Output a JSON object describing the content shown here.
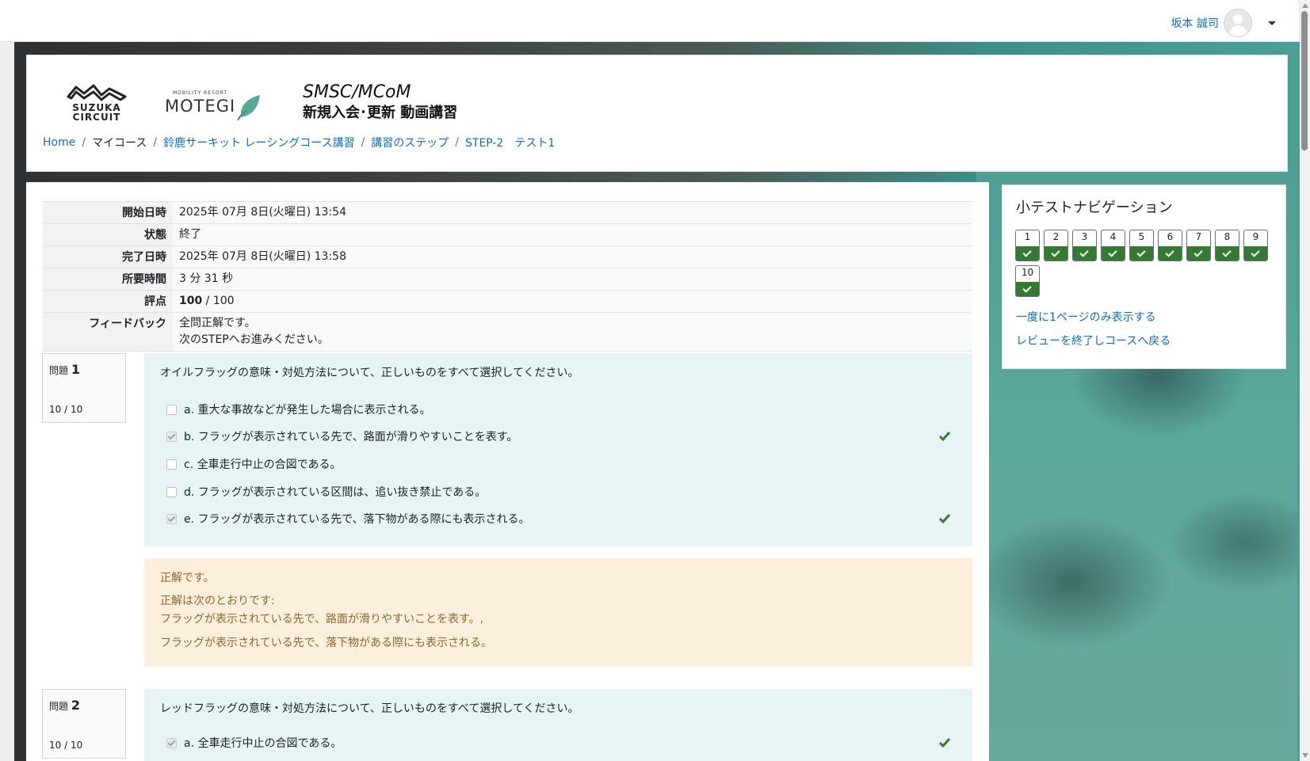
{
  "navbar": {
    "user_name": "坂本 誠司"
  },
  "header": {
    "logo_suzuka_text": "SUZUKA CIRCUIT",
    "logo_motegi_small": "MOBILITY RESORT",
    "logo_motegi_big": "MOTEGI",
    "title_line1": "SMSC/MCoM",
    "title_line2": "新規入会･更新 動画講習",
    "breadcrumb": [
      "Home",
      "マイコース",
      "鈴鹿サーキット レーシングコース講習",
      "講習のステップ",
      "STEP-2　テスト1"
    ]
  },
  "summary": {
    "rows": [
      {
        "label": "開始日時",
        "value": "2025年 07月 8日(火曜日) 13:54"
      },
      {
        "label": "状態",
        "value": "終了"
      },
      {
        "label": "完了日時",
        "value": "2025年 07月 8日(火曜日) 13:58"
      },
      {
        "label": "所要時間",
        "value": "3 分 31 秒"
      }
    ],
    "grade_label": "評点",
    "grade_value": "100",
    "grade_max": " / 100",
    "feedback_label": "フィードバック",
    "feedback_line1": "全問正解です。",
    "feedback_line2": "次のSTEPへお進みください。"
  },
  "questions": [
    {
      "label": "問題",
      "number": "1",
      "mark": "10 / 10",
      "text": "オイルフラッグの意味・対処方法について、正しいものをすべて選択してください。",
      "answers": [
        {
          "text": "a. 重大な事故などが発生した場合に表示される。",
          "checked": false,
          "correct": false
        },
        {
          "text": "b. フラッグが表示されている先で、路面が滑りやすいことを表す。",
          "checked": true,
          "correct": true
        },
        {
          "text": "c. 全車走行中止の合図である。",
          "checked": false,
          "correct": false
        },
        {
          "text": "d. フラッグが表示されている区間は、追い抜き禁止である。",
          "checked": false,
          "correct": false
        },
        {
          "text": "e. フラッグが表示されている先で、落下物がある際にも表示される。",
          "checked": true,
          "correct": true
        }
      ],
      "feedback": "正解です。",
      "right_answer_intro": "正解は次のとおりです:",
      "right_answer_1": "フラッグが表示されている先で、路面が滑りやすいことを表す。,",
      "right_answer_2": "フラッグが表示されている先で、落下物がある際にも表示される。"
    },
    {
      "label": "問題",
      "number": "2",
      "mark": "10 / 10",
      "text": "レッドフラッグの意味・対処方法について、正しいものをすべて選択してください。",
      "answers": [
        {
          "text": "a. 全車走行中止の合図である。",
          "checked": true,
          "correct": true
        }
      ]
    }
  ],
  "quiz_nav": {
    "title": "小テストナビゲーション",
    "buttons": [
      "1",
      "2",
      "3",
      "4",
      "5",
      "6",
      "7",
      "8",
      "9",
      "10"
    ],
    "link_single_page": "一度に1ページのみ表示する",
    "link_finish_review": "レビューを終了しコースへ戻る"
  },
  "colors": {
    "link": "#0f6cbf",
    "correct": "#357a32",
    "formulation_bg": "#e7f3f5",
    "outcome_bg": "#fcefdc"
  }
}
